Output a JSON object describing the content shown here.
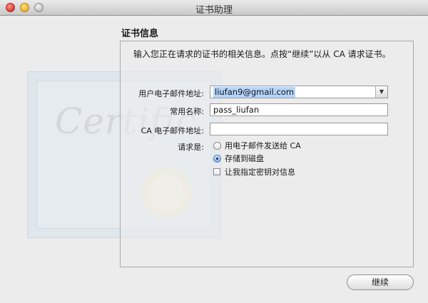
{
  "window": {
    "title": "证书助理"
  },
  "section": {
    "title": "证书信息"
  },
  "intro": "输入您正在请求的证书的相关信息。点按“继续”以从 CA 请求证书。",
  "watermark": {
    "word": "Certific"
  },
  "form": {
    "user_email": {
      "label": "用户电子邮件地址:",
      "value": "liufan9@gmail.com"
    },
    "common_name": {
      "label": "常用名称:",
      "value": "pass_liufan"
    },
    "ca_email": {
      "label": "CA 电子邮件地址:",
      "value": ""
    },
    "request": {
      "label": "请求是:",
      "options": [
        {
          "label": "用电子邮件发送给 CA",
          "selected": false
        },
        {
          "label": "存储到磁盘",
          "selected": true
        }
      ],
      "checkbox": {
        "label": "让我指定密钥对信息",
        "checked": false
      }
    }
  },
  "buttons": {
    "continue": "继续"
  },
  "icons": {
    "dropdown": "chevron-down-icon"
  },
  "colors": {
    "selection": "#b5d5ff",
    "radio_accent": "#4f7fb8"
  }
}
